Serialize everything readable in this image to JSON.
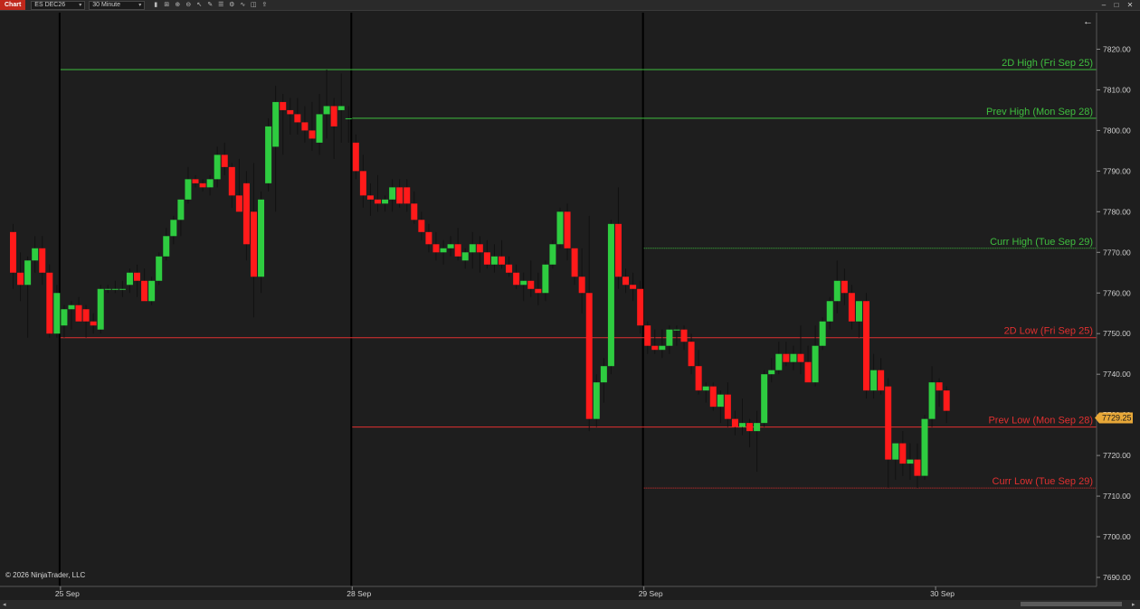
{
  "toolbar": {
    "tab_label": "Chart",
    "instrument": "ES DEC26",
    "interval": "30 Minute",
    "icons": [
      "bar-type-icon",
      "draw-tools-icon",
      "zoom-in-icon",
      "zoom-out-icon",
      "cursor-icon",
      "pencil-icon",
      "properties-icon",
      "strategy-icon",
      "indicator-icon",
      "chart-trader-icon",
      "share-icon"
    ]
  },
  "window_controls": [
    "minimize",
    "maximize",
    "close"
  ],
  "copyright": "© 2026 NinjaTrader, LLC",
  "back_arrow": "←",
  "colors": {
    "background": "#1e1e1e",
    "up_candle": "#2ecc40",
    "down_candle": "#ff1a1a",
    "high_levels": "#3fbf3f",
    "low_levels": "#e03030",
    "price_marker": "#e8a838"
  },
  "chart_data": {
    "type": "candlestick",
    "instrument": "ES DEC26",
    "interval": "30 Minute",
    "y_axis": {
      "ylim": [
        7688,
        7829
      ],
      "ticks": [
        7690,
        7700,
        7710,
        7720,
        7730,
        7740,
        7750,
        7760,
        7770,
        7780,
        7790,
        7800,
        7810,
        7820
      ],
      "tick_labels": [
        "7690.00",
        "7700.00",
        "7710.00",
        "7720.00",
        "7730.00",
        "7740.00",
        "7750.00",
        "7760.00",
        "7770.00",
        "7780.00",
        "7790.00",
        "7800.00",
        "7810.00",
        "7820.00"
      ]
    },
    "x_axis": {
      "date_labels": [
        "25 Sep",
        "28 Sep",
        "29 Sep",
        "30 Sep"
      ],
      "session_breaks_after_bar": [
        6,
        46,
        86
      ]
    },
    "last_price": "7729.25",
    "levels": [
      {
        "label": "2D High (Fri Sep 25)",
        "price": 7815,
        "kind": "high",
        "style": "solid",
        "from_bar": 6
      },
      {
        "label": "Prev High (Mon Sep 28)",
        "price": 7803,
        "kind": "high",
        "style": "solid",
        "from_bar": 46
      },
      {
        "label": "Curr High (Tue Sep 29)",
        "price": 7771,
        "kind": "high",
        "style": "dotted",
        "from_bar": 86
      },
      {
        "label": "2D Low (Fri Sep 25)",
        "price": 7749,
        "kind": "low",
        "style": "solid",
        "from_bar": 6
      },
      {
        "label": "Prev Low (Mon Sep 28)",
        "price": 7727,
        "kind": "low",
        "style": "solid",
        "from_bar": 46
      },
      {
        "label": "Curr Low (Tue Sep 29)",
        "price": 7712,
        "kind": "low",
        "style": "dotted",
        "from_bar": 86
      }
    ],
    "candles": [
      [
        7775,
        7777,
        7761,
        7765
      ],
      [
        7765,
        7770,
        7758,
        7762
      ],
      [
        7762,
        7769,
        7749,
        7768
      ],
      [
        7768,
        7774,
        7765,
        7771
      ],
      [
        7771,
        7774,
        7762,
        7765
      ],
      [
        7765,
        7767,
        7749,
        7750
      ],
      [
        7750,
        7762,
        7749,
        7760
      ],
      [
        7752,
        7757,
        7749,
        7756
      ],
      [
        7756,
        7758,
        7751,
        7757
      ],
      [
        7757,
        7759,
        7753,
        7753
      ],
      [
        7756,
        7757,
        7749,
        7753
      ],
      [
        7753,
        7755,
        7750,
        7752
      ],
      [
        7751,
        7762,
        7750,
        7761
      ],
      [
        7761,
        7762,
        7760,
        7761
      ],
      [
        7761,
        7763,
        7760,
        7761
      ],
      [
        7761,
        7763,
        7759,
        7761
      ],
      [
        7762,
        7766,
        7760,
        7765
      ],
      [
        7765,
        7767,
        7759,
        7763
      ],
      [
        7763,
        7766,
        7758,
        7758
      ],
      [
        7758,
        7764,
        7757,
        7763
      ],
      [
        7763,
        7770,
        7762,
        7769
      ],
      [
        7769,
        7776,
        7768,
        7774
      ],
      [
        7774,
        7779,
        7772,
        7778
      ],
      [
        7778,
        7783,
        7774,
        7783
      ],
      [
        7783,
        7791,
        7782,
        7788
      ],
      [
        7788,
        7789,
        7786,
        7787
      ],
      [
        7787,
        7788,
        7785,
        7786
      ],
      [
        7786,
        7789,
        7784,
        7788
      ],
      [
        7788,
        7796,
        7786,
        7794
      ],
      [
        7794,
        7797,
        7789,
        7791
      ],
      [
        7791,
        7792,
        7781,
        7784
      ],
      [
        7784,
        7793,
        7780,
        7780
      ],
      [
        7787,
        7790,
        7768,
        7772
      ],
      [
        7780,
        7792,
        7754,
        7764
      ],
      [
        7764,
        7785,
        7760,
        7783
      ],
      [
        7787,
        7803,
        7785,
        7801
      ],
      [
        7796,
        7811,
        7780,
        7807
      ],
      [
        7807,
        7809,
        7794,
        7805
      ],
      [
        7805,
        7808,
        7799,
        7804
      ],
      [
        7804,
        7808,
        7799,
        7802
      ],
      [
        7802,
        7806,
        7797,
        7800
      ],
      [
        7800,
        7807,
        7795,
        7798
      ],
      [
        7797,
        7809,
        7794,
        7804
      ],
      [
        7804,
        7815,
        7798,
        7806
      ],
      [
        7806,
        7808,
        7793,
        7801
      ],
      [
        7805,
        7814,
        7797,
        7806
      ],
      [
        7803,
        7806,
        7797,
        7803
      ],
      [
        7797,
        7799,
        7788,
        7790
      ],
      [
        7790,
        7794,
        7781,
        7784
      ],
      [
        7784,
        7787,
        7779,
        7783
      ],
      [
        7783,
        7789,
        7780,
        7782
      ],
      [
        7782,
        7784,
        7780,
        7783
      ],
      [
        7783,
        7788,
        7780,
        7786
      ],
      [
        7786,
        7788,
        7781,
        7782
      ],
      [
        7786,
        7788,
        7780,
        7782
      ],
      [
        7782,
        7785,
        7777,
        7778
      ],
      [
        7778,
        7780,
        7773,
        7775
      ],
      [
        7775,
        7777,
        7770,
        7772
      ],
      [
        7772,
        7775,
        7768,
        7770
      ],
      [
        7770,
        7773,
        7767,
        7771
      ],
      [
        7771,
        7774,
        7769,
        7772
      ],
      [
        7772,
        7776,
        7768,
        7769
      ],
      [
        7768,
        7771,
        7766,
        7770
      ],
      [
        7770,
        7775,
        7766,
        7772
      ],
      [
        7772,
        7774,
        7765,
        7770
      ],
      [
        7770,
        7773,
        7766,
        7767
      ],
      [
        7767,
        7772,
        7765,
        7769
      ],
      [
        7769,
        7773,
        7766,
        7767
      ],
      [
        7767,
        7769,
        7764,
        7765
      ],
      [
        7765,
        7767,
        7761,
        7762
      ],
      [
        7762,
        7765,
        7758,
        7763
      ],
      [
        7763,
        7768,
        7759,
        7761
      ],
      [
        7761,
        7765,
        7757,
        7760
      ],
      [
        7760,
        7768,
        7758,
        7767
      ],
      [
        7767,
        7773,
        7766,
        7772
      ],
      [
        7772,
        7781,
        7771,
        7780
      ],
      [
        7780,
        7782,
        7768,
        7771
      ],
      [
        7771,
        7771,
        7762,
        7764
      ],
      [
        7764,
        7771,
        7755,
        7760
      ],
      [
        7760,
        7779,
        7726,
        7729
      ],
      [
        7729,
        7740,
        7727,
        7738
      ],
      [
        7738,
        7744,
        7733,
        7742
      ],
      [
        7742,
        7778,
        7740,
        7777
      ],
      [
        7777,
        7786,
        7761,
        7764
      ],
      [
        7764,
        7766,
        7760,
        7762
      ],
      [
        7762,
        7765,
        7758,
        7761
      ],
      [
        7761,
        7763,
        7750,
        7752
      ],
      [
        7752,
        7753,
        7745,
        7747
      ],
      [
        7747,
        7751,
        7745,
        7746
      ],
      [
        7746,
        7751,
        7744,
        7747
      ],
      [
        7747,
        7752,
        7745,
        7751
      ],
      [
        7751,
        7752,
        7747,
        7751
      ],
      [
        7751,
        7752,
        7746,
        7748
      ],
      [
        7748,
        7750,
        7740,
        7742
      ],
      [
        7742,
        7746,
        7735,
        7736
      ],
      [
        7736,
        7738,
        7733,
        7737
      ],
      [
        7737,
        7738,
        7731,
        7732
      ],
      [
        7732,
        7736,
        7728,
        7735
      ],
      [
        7735,
        7738,
        7727,
        7729
      ],
      [
        7729,
        7731,
        7725,
        7727
      ],
      [
        7727,
        7734,
        7725,
        7728
      ],
      [
        7728,
        7729,
        7722,
        7726
      ],
      [
        7726,
        7731,
        7716,
        7728
      ],
      [
        7728,
        7741,
        7727,
        7740
      ],
      [
        7740,
        7744,
        7738,
        7741
      ],
      [
        7741,
        7748,
        7740,
        7745
      ],
      [
        7745,
        7748,
        7742,
        7743
      ],
      [
        7743,
        7747,
        7741,
        7745
      ],
      [
        7745,
        7752,
        7740,
        7743
      ],
      [
        7743,
        7747,
        7740,
        7738
      ],
      [
        7738,
        7752,
        7737,
        7747
      ],
      [
        7747,
        7754,
        7746,
        7753
      ],
      [
        7753,
        7759,
        7751,
        7758
      ],
      [
        7758,
        7768,
        7755,
        7763
      ],
      [
        7763,
        7766,
        7757,
        7760
      ],
      [
        7760,
        7762,
        7751,
        7753
      ],
      [
        7753,
        7758,
        7749,
        7758
      ],
      [
        7758,
        7760,
        7734,
        7736
      ],
      [
        7736,
        7745,
        7734,
        7741
      ],
      [
        7741,
        7744,
        7735,
        7736
      ],
      [
        7737,
        7739,
        7712,
        7719
      ],
      [
        7719,
        7723,
        7714,
        7723
      ],
      [
        7723,
        7726,
        7715,
        7718
      ],
      [
        7718,
        7723,
        7714,
        7719
      ],
      [
        7719,
        7723,
        7712,
        7715
      ],
      [
        7715,
        7730,
        7714,
        7729
      ],
      [
        7729,
        7742,
        7727,
        7738
      ],
      [
        7738,
        7739,
        7732,
        7736
      ],
      [
        7736,
        7737,
        7728,
        7731
      ]
    ]
  }
}
